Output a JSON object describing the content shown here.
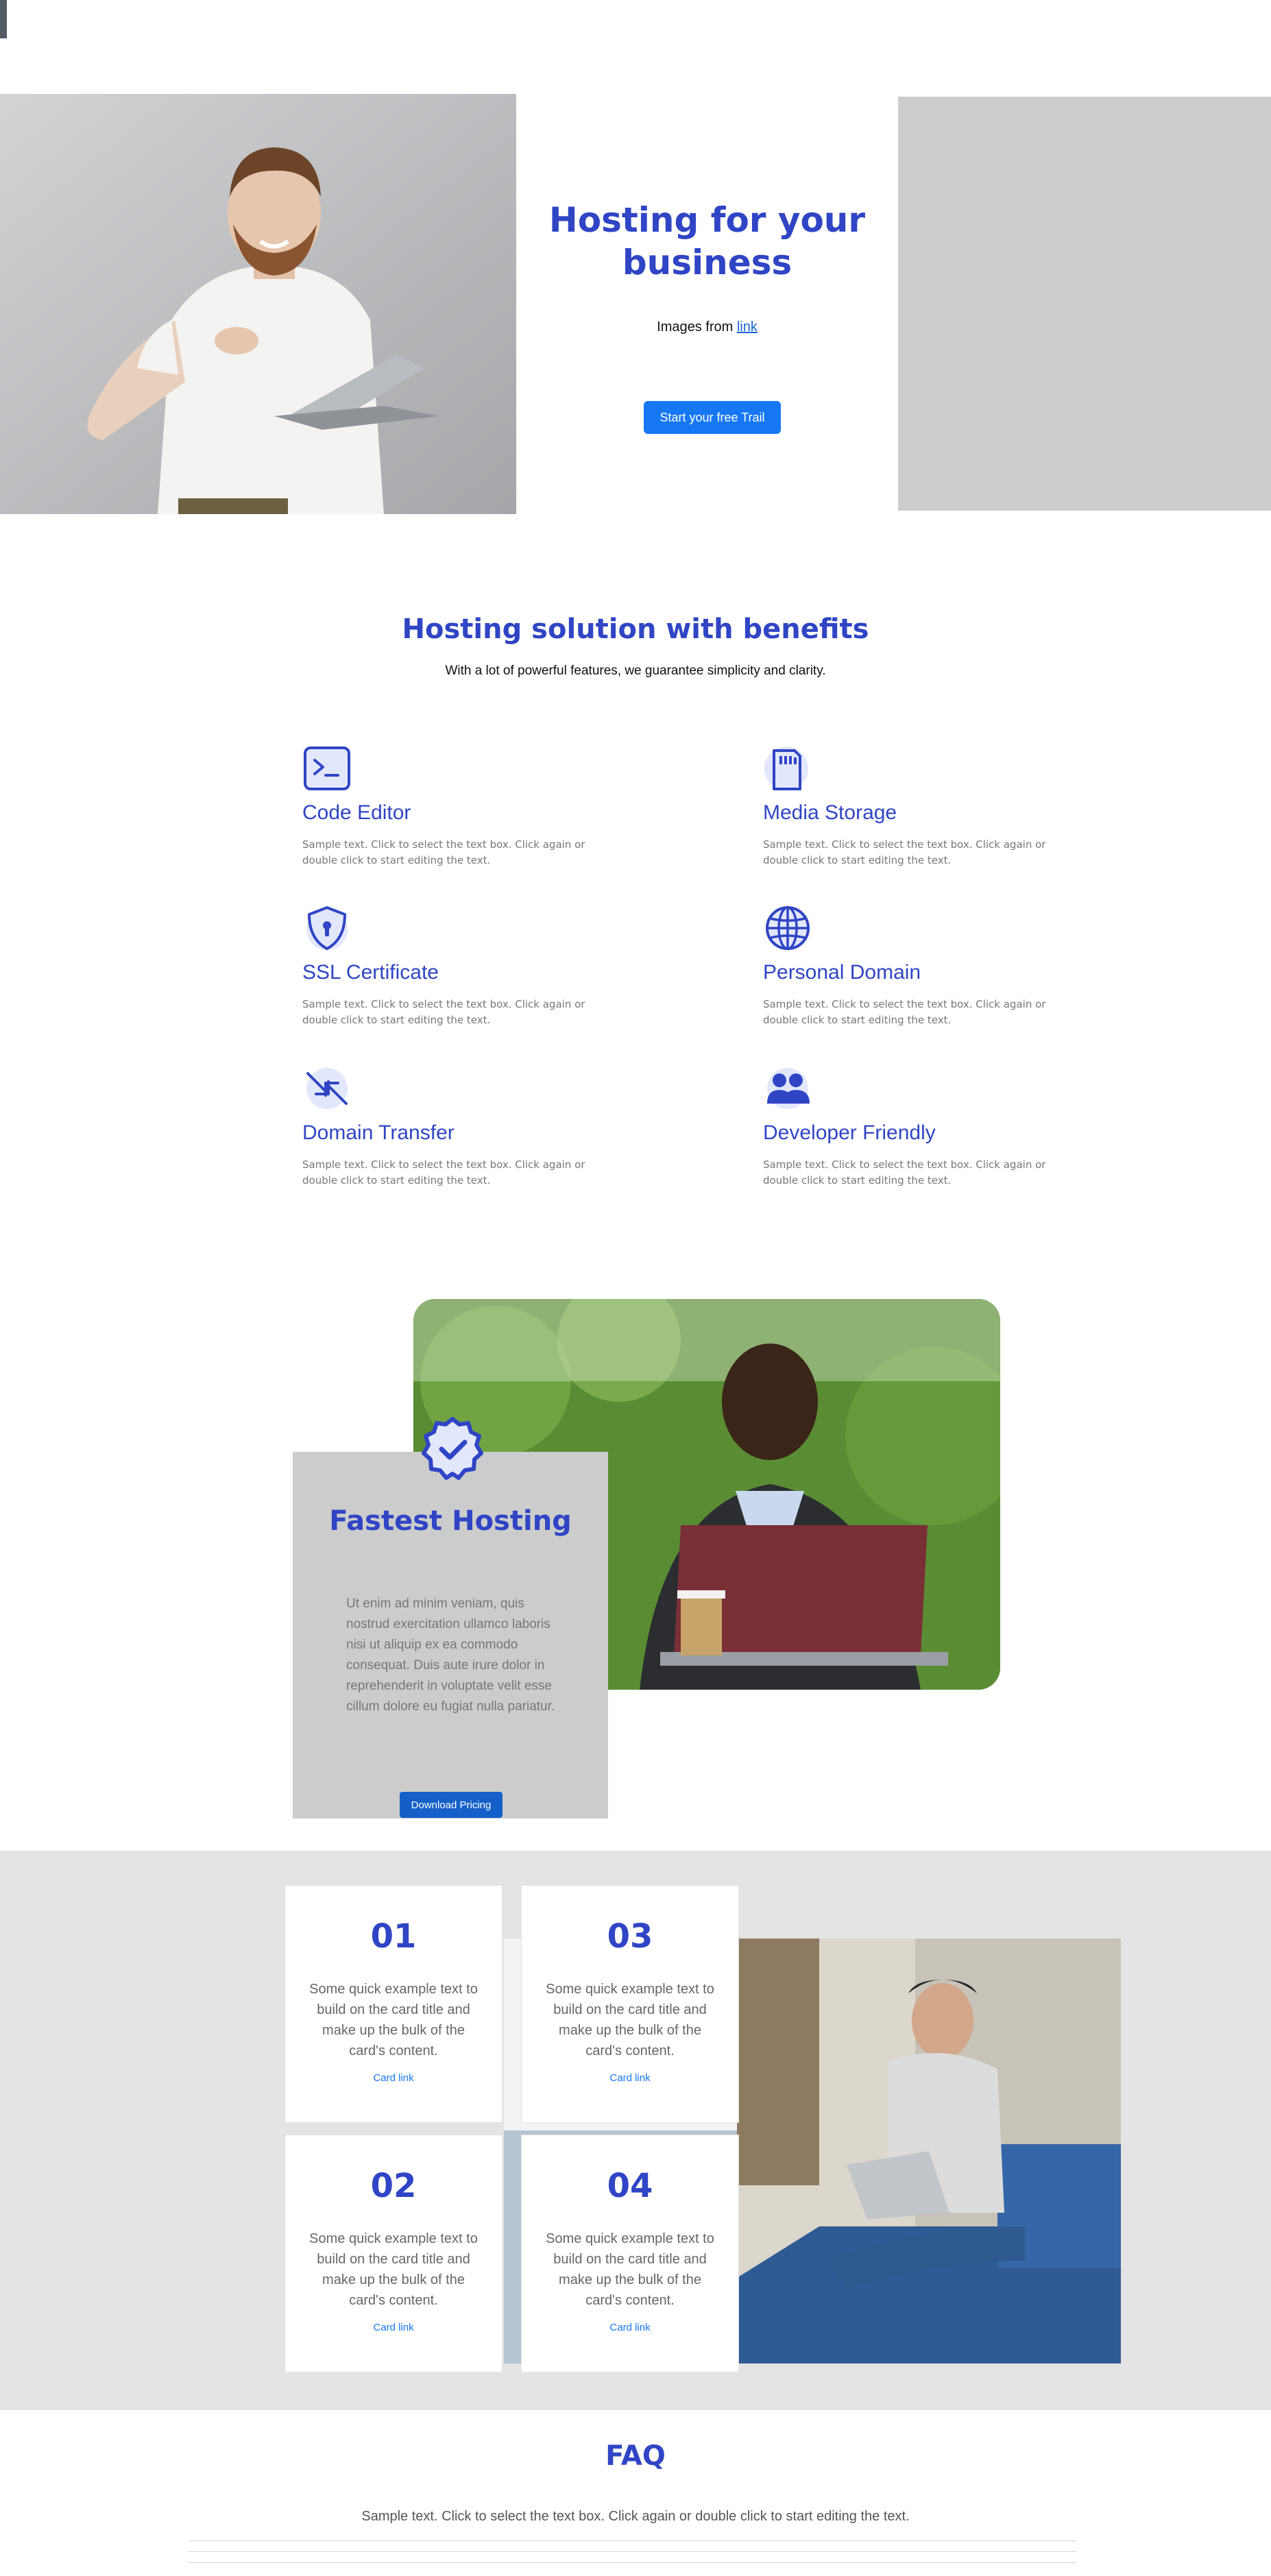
{
  "hero": {
    "title": "Hosting for your business",
    "images_prefix": "Images from ",
    "images_link": "link",
    "cta": "Start your free Trail"
  },
  "benefits": {
    "title": "Hosting solution with benefits",
    "subtitle": "With a lot of powerful features, we guarantee simplicity and clarity.",
    "features": [
      {
        "title": "Code Editor",
        "text": "Sample text. Click to select the text box. Click again or double click to start editing the text.",
        "icon": "terminal-icon"
      },
      {
        "title": "Media Storage",
        "text": "Sample text. Click to select the text box. Click again or double click to start editing the text.",
        "icon": "sd-card-icon"
      },
      {
        "title": "SSL Certificate",
        "text": "Sample text. Click to select the text box. Click again or double click to start editing the text.",
        "icon": "shield-lock-icon"
      },
      {
        "title": "Personal Domain",
        "text": "Sample text. Click to select the text box. Click again or double click to start editing the text.",
        "icon": "globe-icon"
      },
      {
        "title": "Domain Transfer",
        "text": "Sample text. Click to select the text box. Click again or double click to start editing the text.",
        "icon": "transfer-arrows-icon"
      },
      {
        "title": "Developer Friendly",
        "text": "Sample text. Click to select the text box. Click again or double click to start editing the text.",
        "icon": "users-icon"
      }
    ]
  },
  "fastest": {
    "title": "Fastest Hosting",
    "text": "Ut enim ad minim veniam, quis nostrud exercitation ullamco laboris nisi ut aliquip ex ea commodo consequat. Duis aute irure dolor in reprehenderit in voluptate velit esse cillum dolore eu fugiat nulla pariatur.",
    "button": "Download Pricing",
    "icon": "verified-badge-icon"
  },
  "steps": [
    {
      "number": "01",
      "text": "Some quick example text to build on the card title and make up the bulk of the card's content.",
      "link": "Card link"
    },
    {
      "number": "03",
      "text": "Some quick example text to build on the card title and make up the bulk of the card's content.",
      "link": "Card link"
    },
    {
      "number": "02",
      "text": "Some quick example text to build on the card title and make up the bulk of the card's content.",
      "link": "Card link"
    },
    {
      "number": "04",
      "text": "Some quick example text to build on the card title and make up the bulk of the card's content.",
      "link": "Card link"
    }
  ],
  "faq": {
    "title": "FAQ",
    "subtitle": "Sample text. Click to select the text box. Click again or double click to start editing the text."
  },
  "colors": {
    "accent": "#2f45c5",
    "button_blue": "#1677f3",
    "gray_band": "#e4e4e4",
    "placeholder_gray": "#cccccc"
  }
}
